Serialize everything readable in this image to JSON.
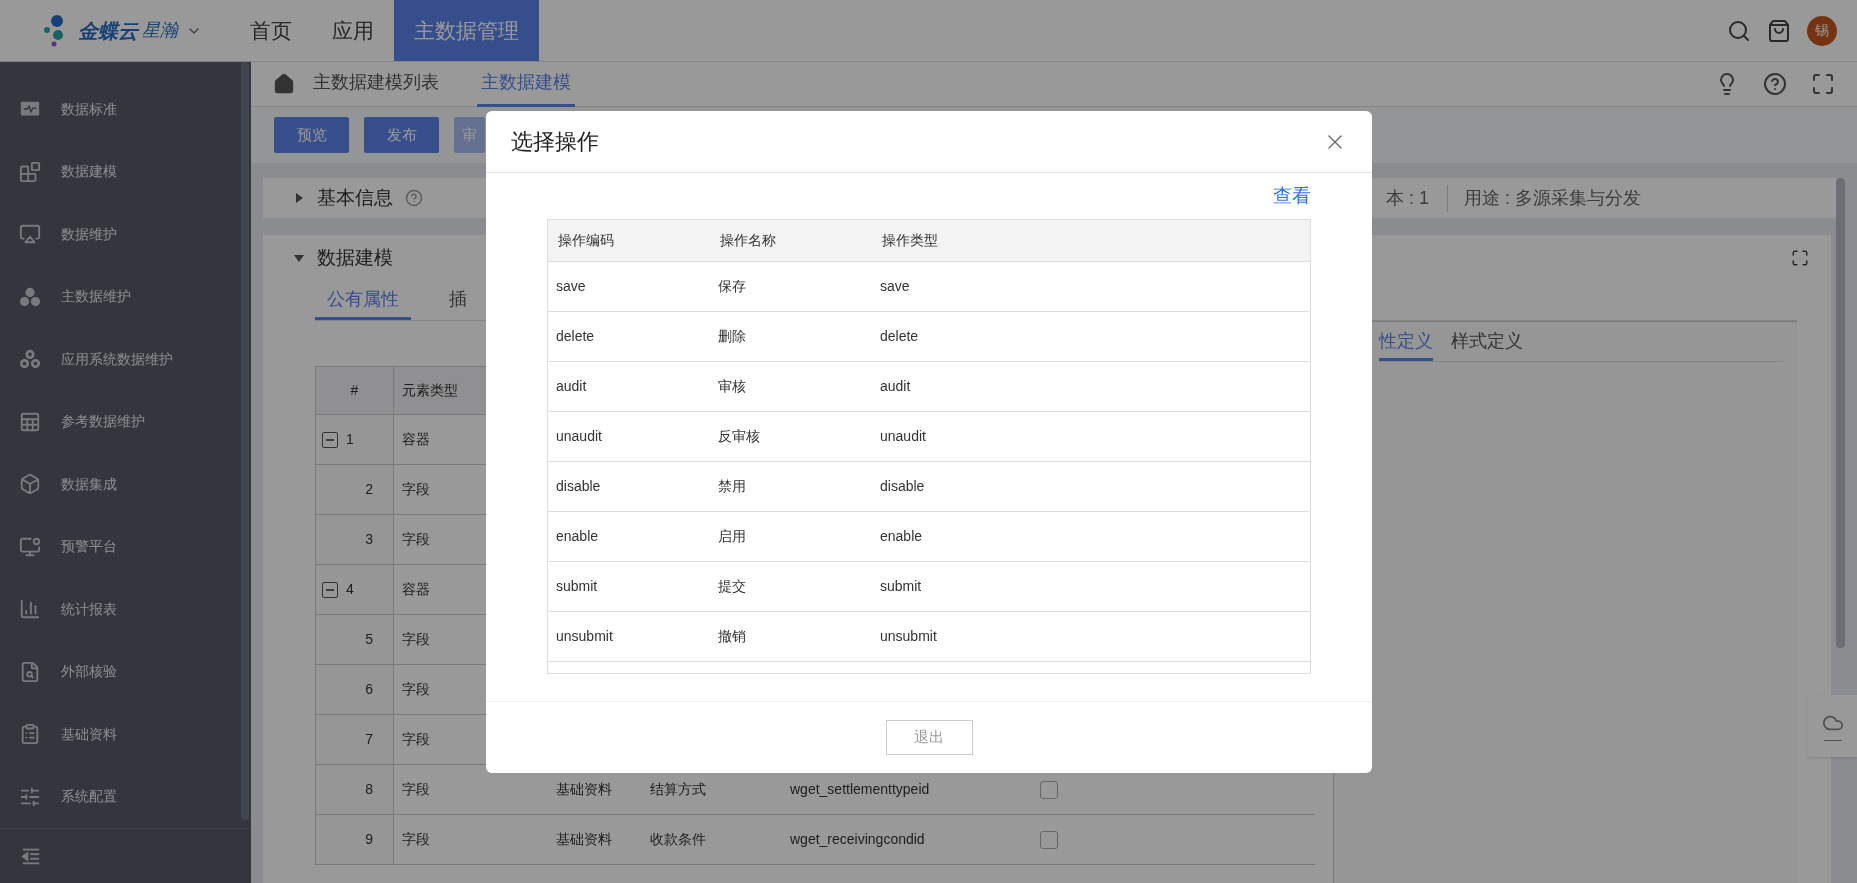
{
  "topbar": {
    "brand": "金蝶云",
    "brand_sub": "星瀚",
    "nav": [
      {
        "label": "首页",
        "selected": false
      },
      {
        "label": "应用",
        "selected": false
      },
      {
        "label": "主数据管理",
        "selected": true
      }
    ],
    "avatar": "锡"
  },
  "sidebar": {
    "items": [
      {
        "label": "数据标准"
      },
      {
        "label": "数据建模"
      },
      {
        "label": "数据维护"
      },
      {
        "label": "主数据维护"
      },
      {
        "label": "应用系统数据维护"
      },
      {
        "label": "参考数据维护"
      },
      {
        "label": "数据集成"
      },
      {
        "label": "预警平台"
      },
      {
        "label": "统计报表"
      },
      {
        "label": "外部核验"
      },
      {
        "label": "基础资料"
      },
      {
        "label": "系统配置"
      }
    ]
  },
  "breadcrumb": [
    {
      "label": "主数据建模列表",
      "selected": false
    },
    {
      "label": "主数据建模",
      "selected": true
    }
  ],
  "toolbar": [
    {
      "label": "预览",
      "disabled": false
    },
    {
      "label": "发布",
      "disabled": false
    },
    {
      "label": "审",
      "disabled": true
    }
  ],
  "basic_info": {
    "title": "基本信息",
    "expanded": false,
    "version": "本 : 1",
    "usage": "用途 : 多源采集与分发"
  },
  "modeling": {
    "title": "数据建模",
    "expanded": true,
    "tabs": [
      {
        "label": "公有属性",
        "selected": true
      },
      {
        "label": "插",
        "selected": false
      }
    ],
    "columns": [
      "#",
      "元素类型"
    ],
    "rows": [
      {
        "index": "1",
        "type": "容器",
        "expanded": true
      },
      {
        "index": "2",
        "type": "字段"
      },
      {
        "index": "3",
        "type": "字段"
      },
      {
        "index": "4",
        "type": "容器",
        "expanded": true
      },
      {
        "index": "5",
        "type": "字段"
      },
      {
        "index": "6",
        "type": "字段"
      },
      {
        "index": "7",
        "type": "字段"
      },
      {
        "index": "8",
        "type": "字段",
        "cells": [
          "基础资料",
          "结算方式",
          "wget_settlementtypeid"
        ],
        "checked": false
      },
      {
        "index": "9",
        "type": "字段",
        "cells": [
          "基础资料",
          "收款条件",
          "wget_receivingcondid"
        ],
        "checked": false
      }
    ],
    "side_tabs": [
      {
        "label": "性定义",
        "selected": true
      },
      {
        "label": "样式定义",
        "selected": false
      }
    ]
  },
  "dialog": {
    "title": "选择操作",
    "link": "查看",
    "columns": [
      "操作编码",
      "操作名称",
      "操作类型"
    ],
    "rows": [
      [
        "save",
        "保存",
        "save"
      ],
      [
        "delete",
        "删除",
        "delete"
      ],
      [
        "audit",
        "审核",
        "audit"
      ],
      [
        "unaudit",
        "反审核",
        "unaudit"
      ],
      [
        "disable",
        "禁用",
        "disable"
      ],
      [
        "enable",
        "启用",
        "enable"
      ],
      [
        "submit",
        "提交",
        "submit"
      ],
      [
        "unsubmit",
        "撤销",
        "unsubmit"
      ]
    ],
    "button": "退出"
  }
}
